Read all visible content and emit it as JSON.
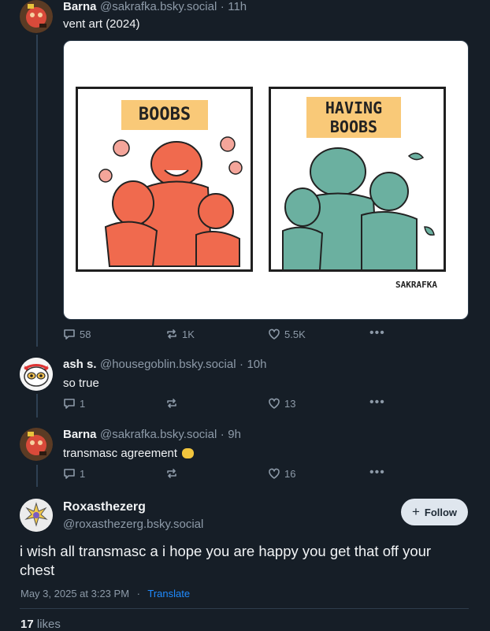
{
  "posts": [
    {
      "author": "Barna",
      "handle": "@sakrafka.bsky.social",
      "time": "11h",
      "text": "vent art (2024)",
      "image": {
        "left_label": "BOOBS",
        "right_label": "HAVING BOOBS",
        "signature": "SAKRAFKA"
      },
      "replies": "58",
      "reposts": "1K",
      "likes": "5.5K"
    },
    {
      "author": "ash s.",
      "handle": "@housegoblin.bsky.social",
      "time": "10h",
      "text": "so true",
      "replies": "1",
      "reposts": "",
      "likes": "13"
    },
    {
      "author": "Barna",
      "handle": "@sakrafka.bsky.social",
      "time": "9h",
      "text": "transmasc agreement",
      "replies": "1",
      "reposts": "",
      "likes": "16"
    }
  ],
  "focus_post": {
    "author": "Roxasthezerg",
    "handle": "@roxasthezerg.bsky.social",
    "follow_label": "Follow",
    "text": "i wish all transmasc a i hope you are happy you get that off your chest",
    "timestamp": "May 3, 2025 at 3:23 PM",
    "translate_label": "Translate",
    "likes_count": "17",
    "likes_label": "likes"
  },
  "separator": "·",
  "colors": {
    "background": "#161e27",
    "muted": "#8d9aa8",
    "link": "#208bfe",
    "thread_line": "#2e4052"
  }
}
